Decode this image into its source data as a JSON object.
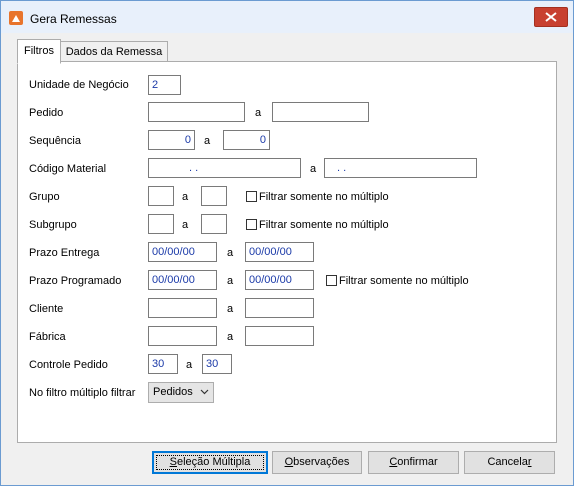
{
  "window": {
    "title": "Gera Remessas"
  },
  "tabs": [
    {
      "label": "Filtros"
    },
    {
      "label": "Dados da Remessa"
    }
  ],
  "form": {
    "unidade": {
      "label": "Unidade de Negócio",
      "value": "2"
    },
    "pedido": {
      "label": "Pedido",
      "from": "",
      "sep": "a",
      "to": ""
    },
    "sequencia": {
      "label": "Sequência",
      "from": "0",
      "sep": "a",
      "to": "0"
    },
    "codigo_material": {
      "label": "Código Material",
      "from": ". .",
      "sep": "a",
      "to": ". ."
    },
    "grupo": {
      "label": "Grupo",
      "from": "",
      "sep": "a",
      "to": "",
      "multiple_label": "Filtrar somente no múltiplo",
      "multiple_checked": false
    },
    "subgrupo": {
      "label": "Subgrupo",
      "from": "",
      "sep": "a",
      "to": "",
      "multiple_label": "Filtrar somente no múltiplo",
      "multiple_checked": false
    },
    "prazo_entrega": {
      "label": "Prazo Entrega",
      "from": "00/00/00",
      "sep": "a",
      "to": "00/00/00"
    },
    "prazo_programado": {
      "label": "Prazo Programado",
      "from": "00/00/00",
      "sep": "a",
      "to": "00/00/00",
      "multiple_label": "Filtrar somente no múltiplo",
      "multiple_checked": false
    },
    "cliente": {
      "label": "Cliente",
      "from": "",
      "sep": "a",
      "to": ""
    },
    "fabrica": {
      "label": "Fábrica",
      "from": "",
      "sep": "a",
      "to": ""
    },
    "controle_pedido": {
      "label": "Controle Pedido",
      "from": "30",
      "sep": "a",
      "to": "30"
    },
    "filtro_multiplo": {
      "label": "No filtro múltiplo filtrar",
      "selected": "Pedidos"
    }
  },
  "buttons": {
    "selecao": {
      "pre": "",
      "u": "S",
      "post": "eleção Múltipla"
    },
    "observacoes": {
      "pre": "",
      "u": "O",
      "post": "bservações"
    },
    "confirmar": {
      "pre": "",
      "u": "C",
      "post": "onfirmar"
    },
    "cancelar": {
      "pre": "Cancela",
      "u": "r",
      "post": ""
    }
  },
  "colors": {
    "accent": "#0078d7",
    "input_text": "#1b3aa8",
    "close": "#c84030"
  },
  "icons": {
    "app": "app-icon",
    "close": "close-icon",
    "dropdown": "chevron-down-icon"
  }
}
